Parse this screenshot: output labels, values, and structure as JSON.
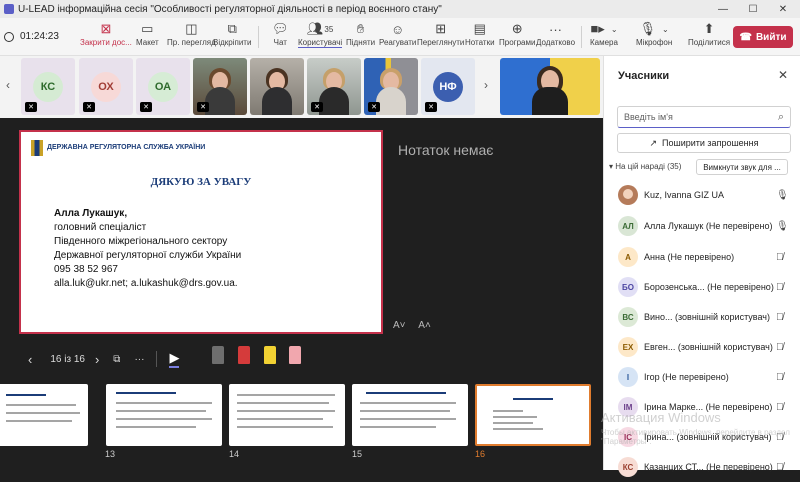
{
  "window": {
    "title": "U-LEAD інформаційна сесія \"Особливості регуляторної діяльності в період воєнного стану\"",
    "minimize": "—",
    "maximize": "☐",
    "close": "✕"
  },
  "toolbar": {
    "timer": "01:24:23",
    "buttons": [
      {
        "label": "Закрити дос...",
        "icon": "close-share-icon"
      },
      {
        "label": "Макет",
        "icon": "layout-icon"
      },
      {
        "label": "Пр. перегляд",
        "icon": "preview-icon"
      },
      {
        "label": "Відкріпити",
        "icon": "popout-icon"
      },
      {
        "label": "Чат",
        "icon": "chat-icon"
      },
      {
        "label": "Користувачі",
        "icon": "people-icon",
        "count": "35"
      },
      {
        "label": "Підняти",
        "icon": "raise-hand-icon"
      },
      {
        "label": "Реагувати",
        "icon": "react-icon"
      },
      {
        "label": "Переглянути",
        "icon": "view-icon"
      },
      {
        "label": "Нотатки",
        "icon": "notes-icon"
      },
      {
        "label": "Програми",
        "icon": "apps-icon"
      },
      {
        "label": "Додатково",
        "icon": "more-icon"
      },
      {
        "label": "Камера",
        "icon": "camera-icon"
      },
      {
        "label": "Мікрофон",
        "icon": "mic-icon"
      },
      {
        "label": "Поділитися",
        "icon": "share-icon"
      }
    ],
    "leave_label": "Вийти"
  },
  "strip": {
    "tiles": [
      {
        "initials": "КС",
        "bg": "#d5ebd3",
        "fg": "#2e6b2c"
      },
      {
        "initials": "ОХ",
        "bg": "#f7d9d7",
        "fg": "#a13d35"
      },
      {
        "initials": "ОА",
        "bg": "#d6ecd5",
        "fg": "#2e6b2c"
      },
      {
        "initials": "НФ",
        "bg": "#3c5fb0",
        "fg": "#ffffff"
      }
    ]
  },
  "sidebar": {
    "title": "Учасники",
    "search_placeholder": "Введіть ім'я",
    "share_invite": "Поширити запрошення",
    "section": "На цій нараді (35)",
    "mute_all": "Вимкнути звук для ...",
    "participants": [
      {
        "initials": "",
        "name": "Kuz, Ivanna GIZ UA",
        "bg": "#b57b5a",
        "fg": "#fff",
        "mic": "on"
      },
      {
        "initials": "АЛ",
        "name": "Алла Лукашук (Не перевірено)",
        "bg": "#d9e6d5",
        "fg": "#3b6b35",
        "mic": "on"
      },
      {
        "initials": "А",
        "name": "Анна (Не перевірено)",
        "bg": "#fde8c8",
        "fg": "#8a5a00",
        "mic": "off"
      },
      {
        "initials": "БО",
        "name": "Борозенська... (Не перевірено)",
        "bg": "#e1dff5",
        "fg": "#4b44a1",
        "mic": "off"
      },
      {
        "initials": "ВС",
        "name": "Вино... (зовнішній користувач)",
        "bg": "#dce9d6",
        "fg": "#3b6b35",
        "mic": "off"
      },
      {
        "initials": "ЕХ",
        "name": "Евген... (зовнішній користувач)",
        "bg": "#fde8c8",
        "fg": "#8a5a00",
        "mic": "off"
      },
      {
        "initials": "І",
        "name": "Ігор (Не перевірено)",
        "bg": "#d6e4f5",
        "fg": "#2d5a9a",
        "mic": "off"
      },
      {
        "initials": "ІМ",
        "name": "Ірина Марке... (Не перевірено)",
        "bg": "#e7dcef",
        "fg": "#6b3e8a",
        "mic": "off"
      },
      {
        "initials": "ІС",
        "name": "Ірина... (зовнішній користувач)",
        "bg": "#f7d9e3",
        "fg": "#9a2e58",
        "mic": "off"
      },
      {
        "initials": "КС",
        "name": "Казанцих СТ... (Не перевірено)",
        "bg": "#f7dcd4",
        "fg": "#9a3e2e",
        "mic": "off"
      }
    ]
  },
  "stage": {
    "slide": {
      "org": "ДЕРЖАВНА РЕГУЛЯТОРНА СЛУЖБА УКРАЇНИ",
      "thanks": "ДЯКУЮ ЗА УВАГУ",
      "lines": [
        "Алла Лукашук,",
        "головний спеціаліст",
        "Південного міжрегіонального сектору",
        "Державної регуляторної служби України",
        "095 38 52 967",
        " alla.luk@ukr.net; a.lukashuk@drs.gov.ua."
      ]
    },
    "notes_empty": "Нотаток немає",
    "font_down": "A˅",
    "font_up": "A˄",
    "page_indicator": "16 із 16",
    "thumbnails": [
      "13",
      "14",
      "15",
      "16"
    ],
    "watermark_title": "Активация Windows",
    "watermark_sub": "Чтобы активировать Windows, перейдите в раздел \"Параметры\"."
  }
}
